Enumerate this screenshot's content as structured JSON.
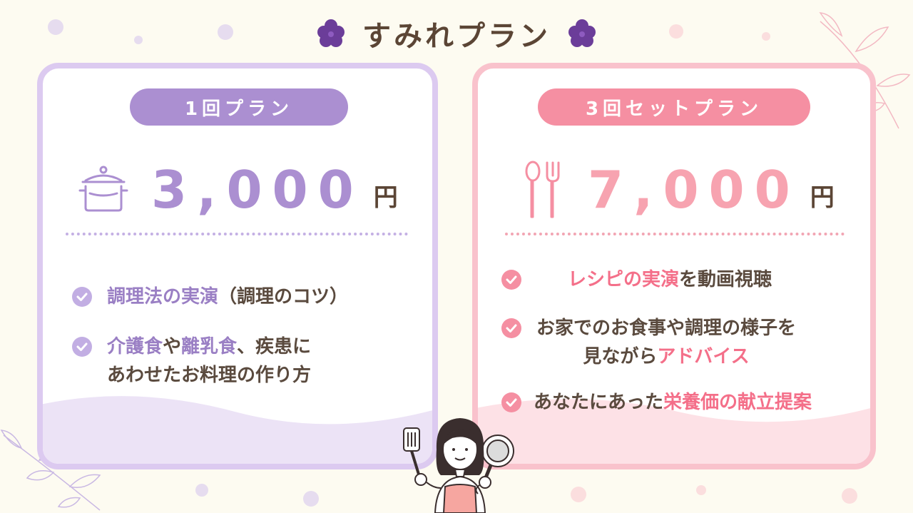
{
  "title": "すみれプラン",
  "colors": {
    "background": "#fdfbf1",
    "purple_accent": "#ab8fd1",
    "pink_accent": "#f58fa2",
    "text_brown": "#5b4535"
  },
  "plans": [
    {
      "label": "1回プラン",
      "icon": "pot-icon",
      "price": "3,000",
      "currency": "円",
      "features": [
        {
          "line1": [
            "調理法の実演",
            "（調理のコツ）"
          ]
        },
        {
          "line1": [
            "介護食",
            "や",
            "離乳食",
            "、疾患に"
          ],
          "line2": "あわせたお料理の作り方"
        }
      ]
    },
    {
      "label": "3回セットプラン",
      "icon": "spoon-fork-icon",
      "price": "7,000",
      "currency": "円",
      "features": [
        {
          "line1": [
            "レシピの実演",
            "を動画視聴"
          ]
        },
        {
          "line1": "お家でのお食事や調理の様子を",
          "line2": [
            "見ながら",
            "アドバイス"
          ]
        },
        {
          "line1": [
            "あなたにあった",
            "栄養価の献立提案"
          ]
        }
      ]
    }
  ],
  "illustration": "woman-cooking-illustration"
}
